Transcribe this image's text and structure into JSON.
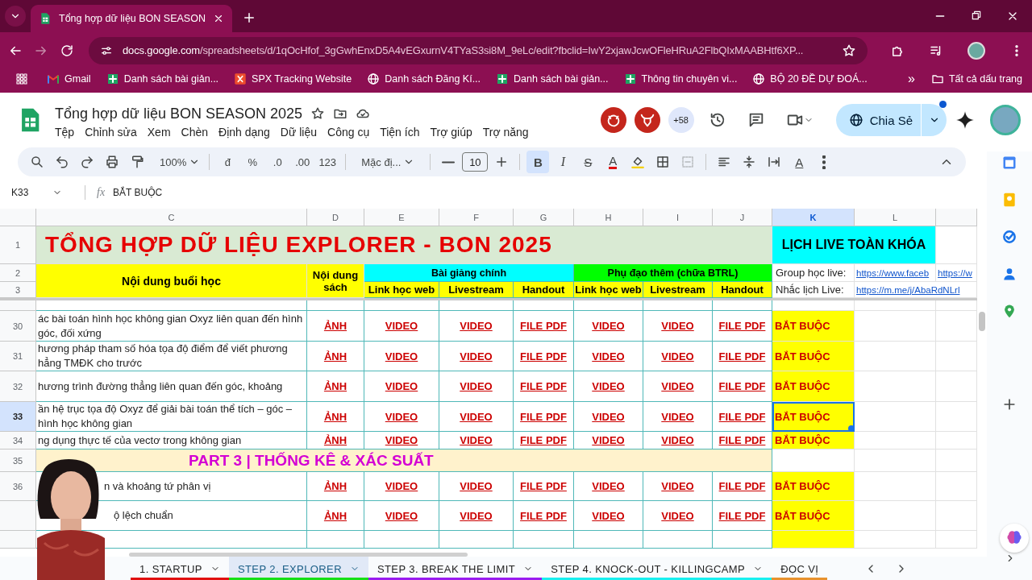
{
  "browser": {
    "tab_title": "Tổng hợp dữ liệu BON SEASON",
    "url_domain": "docs.google.com",
    "url_path": "/spreadsheets/d/1qOcHfof_3gGwhEnxD5A4vEGxurnV4TYaS3si8M_9eLc/edit?fbclid=IwY2xjawJcwOFleHRuA2FlbQIxMAABHtf6XP...",
    "bookmarks": [
      {
        "label": "Gmail",
        "kind": "gmail"
      },
      {
        "label": "Danh sách bài giản...",
        "kind": "sheets"
      },
      {
        "label": "SPX Tracking Website",
        "kind": "spx"
      },
      {
        "label": "Danh sách Đăng Kí...",
        "kind": "globe"
      },
      {
        "label": "Danh sách bài giản...",
        "kind": "sheets"
      },
      {
        "label": "Thông tin chuyên vi...",
        "kind": "sheets"
      },
      {
        "label": "BỘ 20 ĐỀ DỰ ĐOÁ...",
        "kind": "globe"
      }
    ],
    "more": "»",
    "all_bookmarks": "Tất cả dấu trang"
  },
  "doc": {
    "title": "Tổng hợp dữ liệu BON SEASON 2025",
    "menus": [
      "Tệp",
      "Chỉnh sửa",
      "Xem",
      "Chèn",
      "Định dạng",
      "Dữ liệu",
      "Công cụ",
      "Tiện ích",
      "Trợ giúp",
      "Trợ năng"
    ],
    "collaborators_more": "+58",
    "share": "Chia Sẻ"
  },
  "toolbar": {
    "zoom": "100%",
    "currency": "đ",
    "percent": "%",
    "decrease_decimal": ".0",
    "increase_decimal": ".00",
    "number_format": "123",
    "font": "Mặc đị...",
    "font_size": "10",
    "bold_label": "B",
    "bold": true,
    "italic_label": "I",
    "strike_label": "S",
    "text_color_label": "A",
    "rotate_label": "A"
  },
  "formula_bar": {
    "cell": "K33",
    "fx": "fx",
    "value": "BẮT BUỘC"
  },
  "sheet": {
    "columns": [
      {
        "letter": "C",
        "selected": false
      },
      {
        "letter": "D",
        "selected": false
      },
      {
        "letter": "E",
        "selected": false
      },
      {
        "letter": "F",
        "selected": false
      },
      {
        "letter": "G",
        "selected": false
      },
      {
        "letter": "H",
        "selected": false
      },
      {
        "letter": "I",
        "selected": false
      },
      {
        "letter": "J",
        "selected": false
      },
      {
        "letter": "K",
        "selected": true
      },
      {
        "letter": "L",
        "selected": false
      }
    ],
    "header_row_numbers": [
      "1",
      "2",
      "3"
    ],
    "title": "TỔNG HỢP DỮ LIỆU EXPLORER - BON 2025",
    "schedule_title": "LỊCH LIVE TOÀN KHÓA",
    "content_header": "Nội dung buổi học",
    "book_header": "Nội dung sách",
    "main_group": "Bài giảng chính",
    "extra_group": "Phụ đạo thêm (chữa BTRL)",
    "subcolumns": [
      "Link học web",
      "Livestream",
      "Handout",
      "Link học web",
      "Livestream",
      "Handout"
    ],
    "group_label": "Group học live:",
    "group_links": [
      "https://www.faceb",
      "https://w"
    ],
    "reminder_label": "Nhắc lịch Live:",
    "reminder_link": "https://m.me/j/AbaRdNLrl",
    "rows": [
      {
        "number": "30",
        "kind": "lesson",
        "content": "ác bài toán hình học không gian Oxyz liên quan đến hình\ngóc, đối xứng",
        "links": [
          "ẢNH",
          "VIDEO",
          "VIDEO",
          "FILE PDF",
          "VIDEO",
          "VIDEO",
          "FILE PDF"
        ],
        "status": "BẮT BUỘC",
        "selected": false
      },
      {
        "number": "31",
        "kind": "lesson",
        "content": "hương pháp tham số hóa tọa độ điểm để viết phương\nhẳng TMĐK cho trước",
        "links": [
          "ẢNH",
          "VIDEO",
          "VIDEO",
          "FILE PDF",
          "VIDEO",
          "VIDEO",
          "FILE PDF"
        ],
        "status": "BẮT BUỘC",
        "selected": false
      },
      {
        "number": "32",
        "kind": "lesson",
        "content": "hương trình đường thẳng liên quan đến góc, khoảng",
        "links": [
          "ẢNH",
          "VIDEO",
          "VIDEO",
          "FILE PDF",
          "VIDEO",
          "VIDEO",
          "FILE PDF"
        ],
        "status": "BẮT BUỘC",
        "selected": false
      },
      {
        "number": "33",
        "kind": "lesson",
        "content": "ần hệ trục tọa độ Oxyz để giải bài toán thể tích – góc –\nhình học không gian",
        "links": [
          "ẢNH",
          "VIDEO",
          "VIDEO",
          "FILE PDF",
          "VIDEO",
          "VIDEO",
          "FILE PDF"
        ],
        "status": "BẮT BUỘC",
        "selected": true
      },
      {
        "number": "34",
        "kind": "lesson",
        "content": "ng dụng thực tế của vectơ trong không gian",
        "links": [
          "ẢNH",
          "VIDEO",
          "VIDEO",
          "FILE PDF",
          "VIDEO",
          "VIDEO",
          "FILE PDF"
        ],
        "status": "BẮT BUỘC",
        "selected": false
      },
      {
        "number": "35",
        "kind": "section",
        "content": "PART 3 | THỐNG KÊ & XÁC SUẤT",
        "selected": false
      },
      {
        "number": "36",
        "kind": "lesson",
        "content": "n và khoảng tứ phân vị",
        "links": [
          "ẢNH",
          "VIDEO",
          "VIDEO",
          "FILE PDF",
          "VIDEO",
          "VIDEO",
          "FILE PDF"
        ],
        "status": "BẮT BUỘC",
        "selected": false
      },
      {
        "kind": "lesson",
        "content": "ộ lệch chuẩn",
        "links": [
          "ẢNH",
          "VIDEO",
          "VIDEO",
          "FILE PDF",
          "VIDEO",
          "VIDEO",
          "FILE PDF"
        ],
        "status": "BẮT BUỘC",
        "selected": false
      }
    ]
  },
  "sheet_tabs": [
    {
      "label": "1. STARTUP",
      "color": "#e01010",
      "selected": false
    },
    {
      "label": "STEP 2. EXPLORER",
      "color": "#16e016",
      "selected": true
    },
    {
      "label": "STEP 3. BREAK THE LIMIT",
      "color": "#9a1cf0",
      "selected": false
    },
    {
      "label": "STEP 4. KNOCK-OUT - KILLINGCAMP",
      "color": "#18f0f0",
      "selected": false
    },
    {
      "label": "ĐỌC VỊ",
      "color": "#e8922e",
      "selected": false
    }
  ]
}
